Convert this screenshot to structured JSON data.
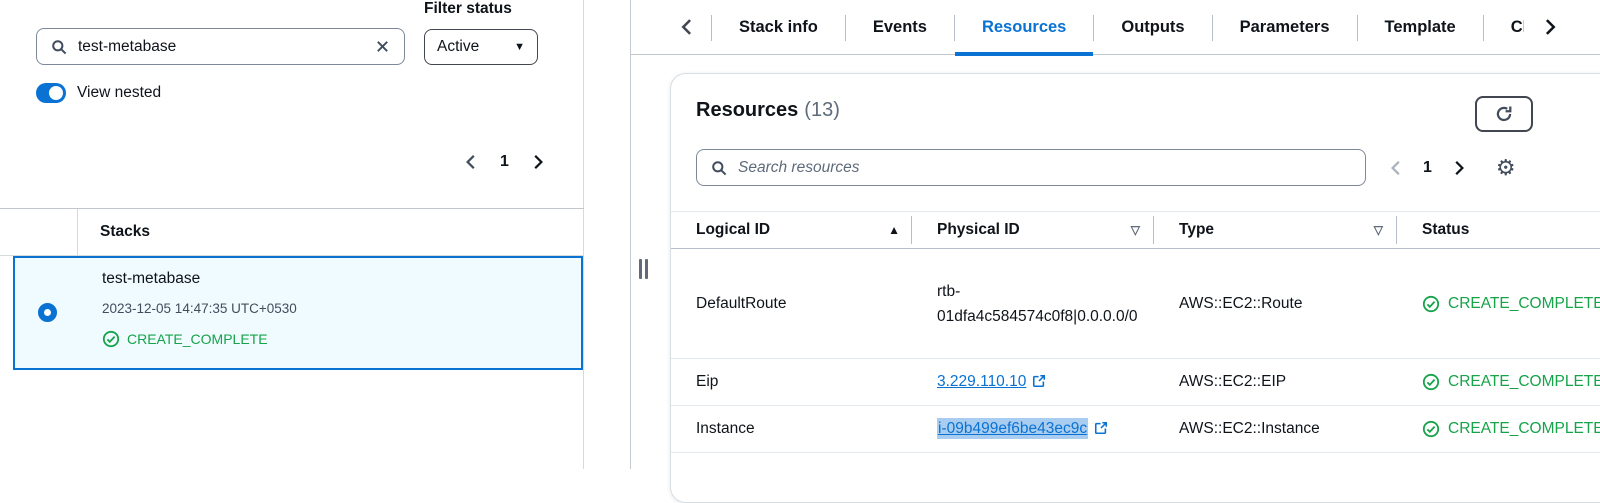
{
  "left_panel": {
    "search_value": "test-metabase",
    "filter_status_label": "Filter status",
    "filter_status_value": "Active",
    "view_nested_label": "View nested",
    "page": "1",
    "stacks_header": "Stacks",
    "stack": {
      "name": "test-metabase",
      "timestamp": "2023-12-05 14:47:35 UTC+0530",
      "status": "CREATE_COMPLETE"
    }
  },
  "tabs": {
    "items": [
      {
        "label": "Stack info"
      },
      {
        "label": "Events"
      },
      {
        "label": "Resources"
      },
      {
        "label": "Outputs"
      },
      {
        "label": "Parameters"
      },
      {
        "label": "Template"
      },
      {
        "label": "Change sets"
      }
    ],
    "active": "Resources"
  },
  "resources": {
    "title": "Resources",
    "count": "(13)",
    "search_placeholder": "Search resources",
    "page": "1",
    "columns": {
      "logical": "Logical ID",
      "physical": "Physical ID",
      "type": "Type",
      "status": "Status"
    },
    "rows": [
      {
        "logical_id": "DefaultRoute",
        "physical_id": "rtb-01dfa4c584574c0f8|0.0.0.0/0",
        "type": "AWS::EC2::Route",
        "status": "CREATE_COMPLETE"
      },
      {
        "logical_id": "Eip",
        "physical_id": "3.229.110.10",
        "type": "AWS::EC2::EIP",
        "status": "CREATE_COMPLETE"
      },
      {
        "logical_id": "Instance",
        "physical_id": "i-09b499ef6be43ec9c",
        "type": "AWS::EC2::Instance",
        "status": "CREATE_COMPLETE"
      }
    ]
  },
  "icons": {
    "gear": "⚙",
    "caret_down": "▼",
    "sort_asc": "▲",
    "sort_down": "▽"
  },
  "colors": {
    "accent": "#0972d3",
    "success": "#16a34a",
    "selected_card_bg": "#f0fbff",
    "selection_highlight": "#a9cdf0"
  }
}
